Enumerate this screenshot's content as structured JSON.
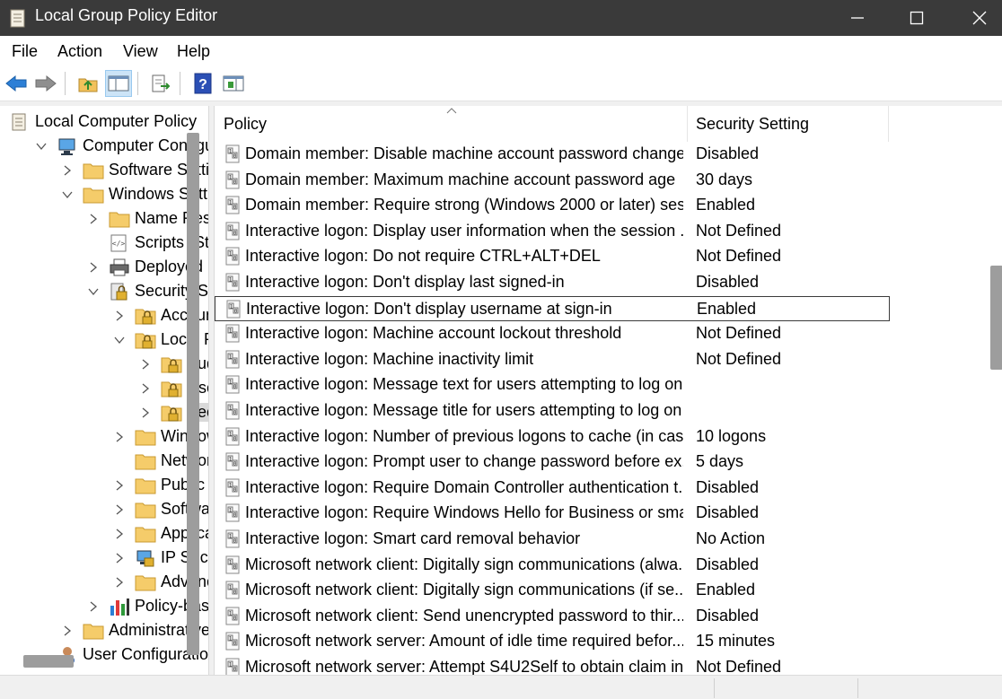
{
  "window": {
    "title": "Local Group Policy Editor",
    "minimize_icon": "minimize-icon",
    "maximize_icon": "maximize-icon",
    "close_icon": "close-icon"
  },
  "menu": [
    "File",
    "Action",
    "View",
    "Help"
  ],
  "toolbar": [
    "back-arrow-icon",
    "forward-arrow-icon",
    "up-folder-icon",
    "show-hide-tree-icon",
    "export-list-icon",
    "help-icon",
    "show-hide-action-pane-icon"
  ],
  "tree": [
    {
      "label": "Local Computer Policy",
      "icon": "policy-icon",
      "expander": "none"
    },
    {
      "label": "Computer Configuration",
      "icon": "computer-icon",
      "expander": "expanded"
    },
    {
      "label": "Software Settings",
      "icon": "folder-icon",
      "expander": "collapsed"
    },
    {
      "label": "Windows Settings",
      "icon": "folder-icon",
      "expander": "expanded"
    },
    {
      "label": "Name Resolution Policy",
      "icon": "folder-icon",
      "expander": "collapsed"
    },
    {
      "label": "Scripts (Startup/Shutdown)",
      "icon": "scripts-icon",
      "expander": "none"
    },
    {
      "label": "Deployed Printers",
      "icon": "printer-icon",
      "expander": "collapsed"
    },
    {
      "label": "Security Settings",
      "icon": "security-icon",
      "expander": "expanded"
    },
    {
      "label": "Account Policies",
      "icon": "lock-folder-icon",
      "expander": "collapsed"
    },
    {
      "label": "Local Policies",
      "icon": "lock-folder-icon",
      "expander": "expanded"
    },
    {
      "label": "Audit Policy",
      "icon": "lock-folder-icon",
      "expander": "collapsed"
    },
    {
      "label": "User Rights Assignment",
      "icon": "lock-folder-icon",
      "expander": "collapsed"
    },
    {
      "label": "Security Options",
      "icon": "lock-folder-icon",
      "expander": "collapsed",
      "selected": true
    },
    {
      "label": "Windows Defender Firewall",
      "icon": "folder-icon",
      "expander": "collapsed"
    },
    {
      "label": "Network List Manager Policies",
      "icon": "folder-icon",
      "expander": "none"
    },
    {
      "label": "Public Key Policies",
      "icon": "folder-icon",
      "expander": "collapsed"
    },
    {
      "label": "Software Restriction Policies",
      "icon": "folder-icon",
      "expander": "collapsed"
    },
    {
      "label": "Application Control Policies",
      "icon": "folder-icon",
      "expander": "collapsed"
    },
    {
      "label": "IP Security Policies",
      "icon": "ipsec-icon",
      "expander": "collapsed"
    },
    {
      "label": "Advanced Audit Policy",
      "icon": "folder-icon",
      "expander": "collapsed"
    },
    {
      "label": "Policy-based QoS",
      "icon": "chart-icon",
      "expander": "collapsed"
    },
    {
      "label": "Administrative Templates",
      "icon": "folder-icon",
      "expander": "collapsed"
    },
    {
      "label": "User Configuration",
      "icon": "user-icon",
      "expander": "none"
    }
  ],
  "list": {
    "columns": {
      "policy": "Policy",
      "setting": "Security Setting"
    },
    "rows": [
      {
        "policy": "Domain member: Disable machine account password changes",
        "setting": "Disabled"
      },
      {
        "policy": "Domain member: Maximum machine account password age",
        "setting": "30 days"
      },
      {
        "policy": "Domain member: Require strong (Windows 2000 or later) sess...",
        "setting": "Enabled"
      },
      {
        "policy": "Interactive logon: Display user information when the session ...",
        "setting": "Not Defined"
      },
      {
        "policy": "Interactive logon: Do not require CTRL+ALT+DEL",
        "setting": "Not Defined"
      },
      {
        "policy": "Interactive logon: Don't display last signed-in",
        "setting": "Disabled"
      },
      {
        "policy": "Interactive logon: Don't display username at sign-in",
        "setting": "Enabled",
        "focused": true
      },
      {
        "policy": "Interactive logon: Machine account lockout threshold",
        "setting": "Not Defined"
      },
      {
        "policy": "Interactive logon: Machine inactivity limit",
        "setting": "Not Defined"
      },
      {
        "policy": "Interactive logon: Message text for users attempting to log on",
        "setting": ""
      },
      {
        "policy": "Interactive logon: Message title for users attempting to log on",
        "setting": ""
      },
      {
        "policy": "Interactive logon: Number of previous logons to cache (in cas...",
        "setting": "10 logons"
      },
      {
        "policy": "Interactive logon: Prompt user to change password before ex...",
        "setting": "5 days"
      },
      {
        "policy": "Interactive logon: Require Domain Controller authentication t...",
        "setting": "Disabled"
      },
      {
        "policy": "Interactive logon: Require Windows Hello for Business or sma...",
        "setting": "Disabled"
      },
      {
        "policy": "Interactive logon: Smart card removal behavior",
        "setting": "No Action"
      },
      {
        "policy": "Microsoft network client: Digitally sign communications (alwa...",
        "setting": "Disabled"
      },
      {
        "policy": "Microsoft network client: Digitally sign communications (if se...",
        "setting": "Enabled"
      },
      {
        "policy": "Microsoft network client: Send unencrypted password to thir...",
        "setting": "Disabled"
      },
      {
        "policy": "Microsoft network server: Amount of idle time required befor...",
        "setting": "15 minutes"
      },
      {
        "policy": "Microsoft network server: Attempt S4U2Self to obtain claim in...",
        "setting": "Not Defined"
      }
    ]
  }
}
